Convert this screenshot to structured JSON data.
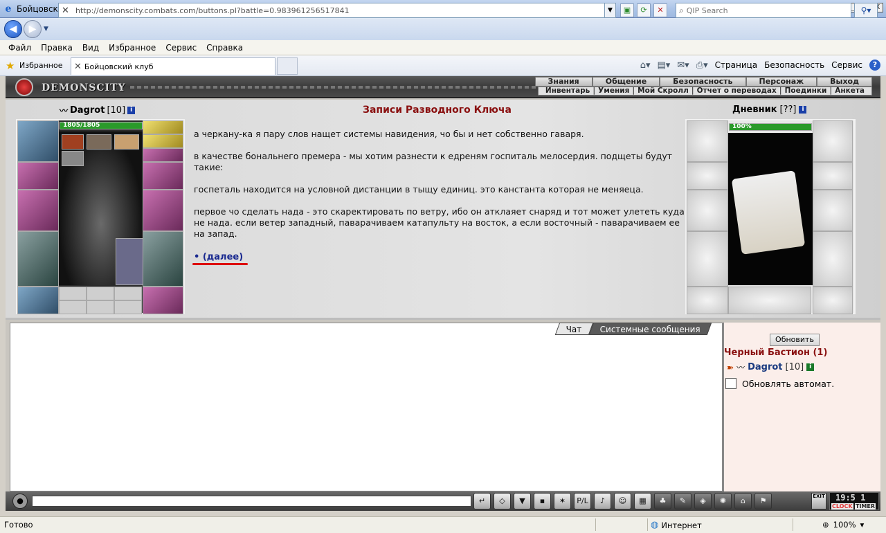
{
  "window": {
    "title": "Бойцовский клуб - Windows Internet Explorer",
    "minimize": "_",
    "maximize": "□",
    "close": "X"
  },
  "address": {
    "url": "http://demonscity.combats.com/buttons.pl?battle=0.983961256517841",
    "search_placeholder": "QIP Search"
  },
  "menu": [
    "Файл",
    "Правка",
    "Вид",
    "Избранное",
    "Сервис",
    "Справка"
  ],
  "favorites": {
    "label": "Избранное",
    "tab_title": "Бойцовский клуб"
  },
  "command_bar": {
    "page": "Страница",
    "safety": "Безопасность",
    "tools": "Сервис",
    "help": "?"
  },
  "game": {
    "logo": "DEMONSCITY",
    "top_nav": [
      "Знания",
      "Общение",
      "Безопасность",
      "Персонаж",
      "Выход"
    ],
    "sub_nav": [
      "Инвентарь",
      "Умения",
      "Мой Скролл",
      "Отчет о переводах",
      "Поединки",
      "Анкета"
    ],
    "character": {
      "name": "Dagrot",
      "level": "[10]",
      "hp": "1805/1805",
      "hp_fraction": 1.0
    },
    "center_title": "Записи Разводного Ключа",
    "paragraphs": [
      "а черкану-ка я пару слов нащет системы навидения, чо бы и нет собственно гаваря.",
      "в качестве бональнего премера - мы хотим разнести к едреням госпиталь мелосердия. подщеты будут такие:",
      "госпеталь находится на условной дистанции в тыщу единиц. это канстанта которая не меняеца.",
      "первое чо сделать нада - это скаректировать по ветру, ибо он атклаяет снаряд и тот может улететь куда не нада. если ветер западный, паварачиваем катапульту на восток, а если восточный - паварачиваем ее на запад."
    ],
    "more_link": "• (далее)",
    "diary": {
      "title": "Дневник",
      "level": "[??]",
      "progress": "100%",
      "progress_fraction": 1.0
    }
  },
  "chat": {
    "tab_chat": "Чат",
    "tab_system": "Системные сообщения"
  },
  "online": {
    "refresh": "Обновить",
    "room": "Черный Бастион (1)",
    "user_name": "Dagrot",
    "user_level": "[10]",
    "auto_refresh": "Обновлять автомат."
  },
  "bottom": {
    "exit": "EXIT",
    "clock_time": "19:5 1",
    "clock_label": "CLOCK",
    "timer_label": "TIMER"
  },
  "status": {
    "text": "Готово",
    "zone": "Интернет",
    "zoom": "100%"
  }
}
